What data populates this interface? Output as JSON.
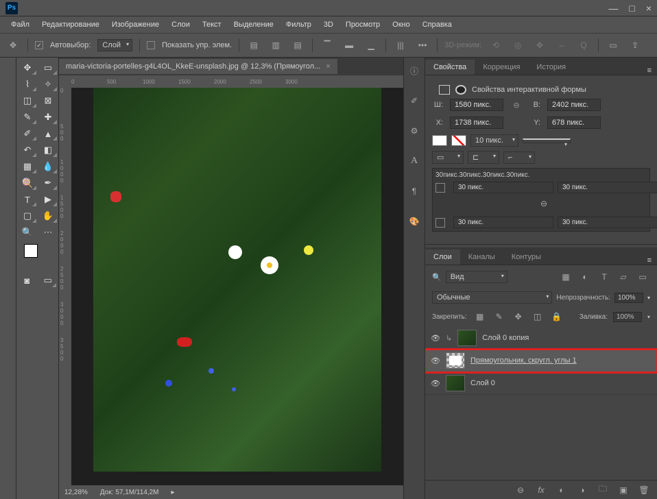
{
  "menu": {
    "file": "Файл",
    "edit": "Редактирование",
    "image": "Изображение",
    "layers": "Слои",
    "text": "Текст",
    "select": "Выделение",
    "filter": "Фильтр",
    "threeD": "3D",
    "view": "Просмотр",
    "window": "Окно",
    "help": "Справка"
  },
  "optbar": {
    "autoselect": "Автовыбор:",
    "autoselect_mode": "Слой",
    "show_controls": "Показать упр. элем.",
    "mode3d": "3D-режим:"
  },
  "doc": {
    "tab_title": "maria-victoria-portelles-g4L4OL_KkeE-unsplash.jpg @ 12,3% (Прямоугол...",
    "zoom": "12,28%",
    "docsize_label": "Док:",
    "docsize": "57,1M/114,2M"
  },
  "ruler_h": [
    "0",
    "500",
    "1000",
    "1500",
    "2000",
    "2500",
    "3000"
  ],
  "ruler_v": [
    "0",
    "5\n0\n0",
    "1\n0\n0\n0",
    "1\n5\n0\n0",
    "2\n0\n0\n0",
    "2\n5\n0\n0",
    "3\n0\n0\n0",
    "3\n5\n0\n0"
  ],
  "panels": {
    "properties": "Свойства",
    "correction": "Коррекция",
    "history": "История",
    "layers": "Слои",
    "channels": "Каналы",
    "paths": "Контуры"
  },
  "props": {
    "title": "Свойства интерактивной формы",
    "w_label": "Ш:",
    "w_value": "1580 пикс.",
    "h_label": "В:",
    "h_value": "2402 пикс.",
    "x_label": "X:",
    "x_value": "1738 пикс.",
    "y_label": "Y:",
    "y_value": "678 пикс.",
    "stroke_width": "10 пикс.",
    "corners_summary": "30пикс.30пикс.30пикс.30пикс.",
    "corner_tl": "30 пикс.",
    "corner_tr": "30 пикс.",
    "corner_bl": "30 пикс.",
    "corner_br": "30 пикс.",
    "link_icon": "⊖"
  },
  "layers": {
    "search_label": "Вид",
    "blend_mode": "Обычные",
    "opacity_label": "Непрозрачность:",
    "opacity_value": "100%",
    "lock_label": "Закрепить:",
    "fill_label": "Заливка:",
    "fill_value": "100%",
    "items": [
      {
        "name": "Слой 0 копия",
        "type": "bitmap"
      },
      {
        "name": "Прямоугольник, скругл. углы 1",
        "type": "shape",
        "selected": true,
        "highlighted": true
      },
      {
        "name": "Слой 0",
        "type": "bitmap"
      }
    ]
  }
}
